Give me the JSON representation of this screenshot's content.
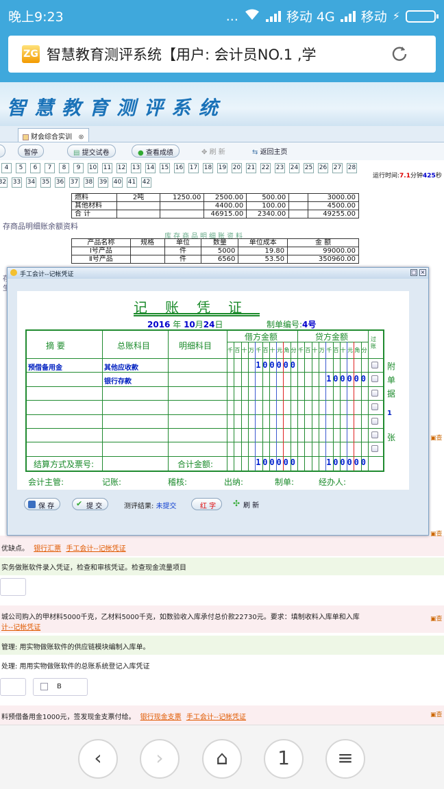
{
  "status_bar": {
    "time": "晚上9:23",
    "dots": "...",
    "carrier1": "移动 4G",
    "carrier2": "移动"
  },
  "browser": {
    "url_title": "智慧教育测评系统【用户: 会计员NO.1 ,学",
    "favicon_text": "ZG"
  },
  "banner": {
    "title": "智慧教育测评系统"
  },
  "tabs": {
    "active": "财会综合实训"
  },
  "toolbar": {
    "pause": "暂停",
    "submit_paper": "提交试卷",
    "view_score": "查看成绩",
    "refresh": "刷 新",
    "back_home": "返回主页"
  },
  "question_numbers_row1": [
    "4",
    "5",
    "6",
    "7",
    "8",
    "9",
    "10",
    "11",
    "12",
    "13",
    "14",
    "15",
    "16",
    "17",
    "18",
    "19",
    "20",
    "21",
    "22",
    "23",
    "24",
    "25",
    "26",
    "27",
    "28"
  ],
  "question_numbers_row2": [
    "32",
    "33",
    "34",
    "35",
    "36",
    "37",
    "38",
    "39",
    "40",
    "41",
    "42"
  ],
  "runtime": {
    "prefix": "运行时间:",
    "minutes": "7.1",
    "min_unit": "分钟",
    "seconds": "425",
    "sec_unit": "秒"
  },
  "material_table": {
    "rows": [
      [
        "燃料",
        "2吨",
        "1250.00",
        "2500.00",
        "500.00",
        "",
        "3000.00"
      ],
      [
        "其他材料",
        "",
        "",
        "4400.00",
        "100.00",
        "",
        "4500.00"
      ],
      [
        "合  计",
        "",
        "",
        "46915.00",
        "2340.00",
        "",
        "49255.00"
      ]
    ]
  },
  "inventory": {
    "section_title": "存商品明细账余额资料",
    "table_title": "库存商品明细账资料",
    "headers": [
      "产品名称",
      "规格",
      "单位",
      "数量",
      "单位成本",
      "金  额"
    ],
    "rows": [
      [
        "Ⅰ号产品",
        "",
        "件",
        "5000",
        "19.80",
        "99000.00"
      ],
      [
        "Ⅱ号产品",
        "",
        "件",
        "6560",
        "53.50",
        "350960.00"
      ]
    ]
  },
  "dialog": {
    "title": "手工会计--记帐凭证",
    "voucher_title": "记账凭证",
    "year": "2016",
    "year_unit": "年",
    "month": "10",
    "month_unit": "月",
    "day": "24",
    "day_unit": "日",
    "voucher_no_label": "制单编号:",
    "voucher_no": "4号",
    "col_summary": "摘    要",
    "col_account": "总账科目",
    "col_detail": "明细科目",
    "col_debit": "借方金额",
    "col_credit": "贷方金额",
    "col_posted": "过账",
    "digit_headers": [
      "千",
      "百",
      "十",
      "万",
      "千",
      "百",
      "十",
      "元",
      "角",
      "分"
    ],
    "entries": [
      {
        "summary": "预借备用金",
        "account": "其他应收款",
        "debit": "100000",
        "credit": ""
      },
      {
        "summary": "",
        "account": "银行存款",
        "debit": "",
        "credit": "100000"
      }
    ],
    "attach": [
      "附",
      "单",
      "据",
      "1",
      "张"
    ],
    "settlement_label": "结算方式及票号:",
    "total_label": "合计金额:",
    "total_debit": "100000",
    "total_credit": "100000",
    "signatures": [
      "会计主管:",
      "记账:",
      "稽核:",
      "出纳:",
      "制单:",
      "经办人:"
    ],
    "buttons": {
      "save": "保 存",
      "submit": "提 交",
      "result_label": "测评结果:",
      "result_value": "未提交",
      "red": "红 字",
      "refresh": "刷 新"
    }
  },
  "background_text": {
    "left_frag1": "存",
    "left_frag2": "生",
    "line1": "优缺点。",
    "link1": "银行汇票",
    "link2": "手工会计--记帐凭证",
    "line2": "实务做账软件录入凭证，检查和审核凭证。检查现金流量项目",
    "line3": "城公司购入的甲材料5000千克，乙材料5000千克，如数验收入库承付总价款22730元。要求：填制收料入库单和入库",
    "link3": "计--记帐凭证",
    "line4": "管理: 用实物做账软件的供应链模块编制入库单。",
    "line5": "处理: 用用实物做账软件的总账系统登记入库凭证",
    "option_b": "B",
    "line6": "料预借备用金1000元，签发现金支票付给。",
    "link4": "银行现金支票",
    "link5": "手工会计--记帐凭证",
    "side_label": "查"
  },
  "nav": {
    "back": "‹",
    "forward": "›",
    "home": "⌂",
    "tabs_count": "1",
    "menu": "≡"
  },
  "colors": {
    "status_bar": "#3fa8dc",
    "voucher_green": "#1f8a2f",
    "entry_blue": "#0020c0",
    "runtime_red": "#dd0000"
  }
}
